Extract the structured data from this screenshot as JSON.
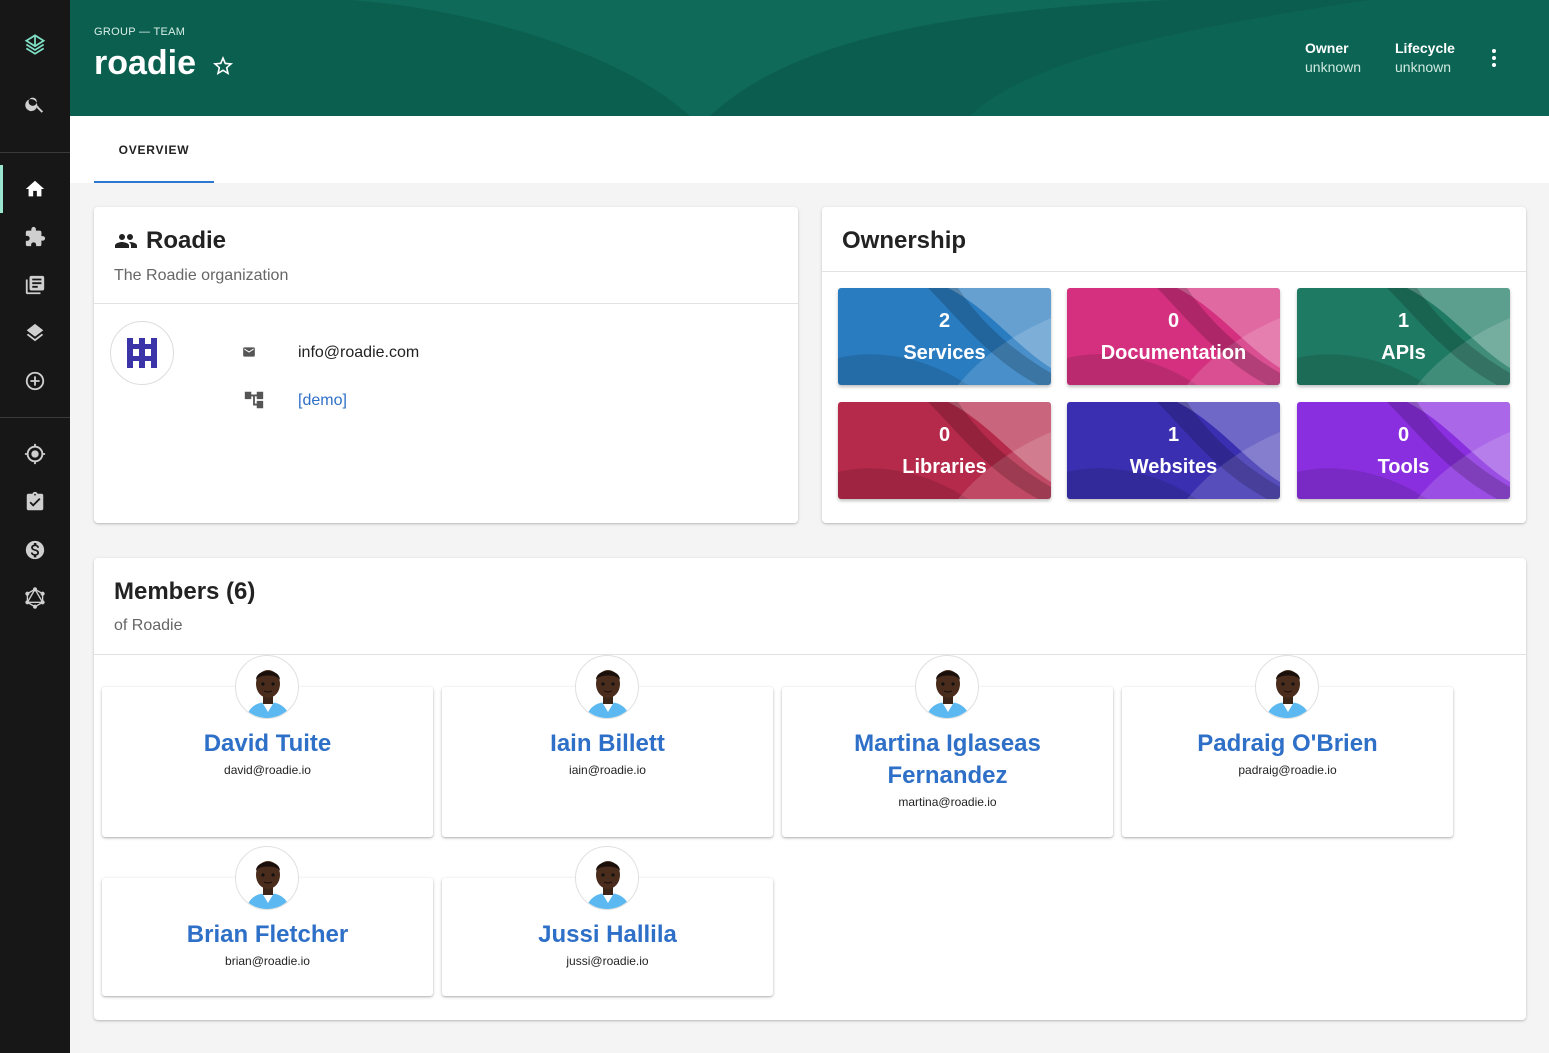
{
  "header": {
    "type_label": "GROUP — TEAM",
    "title": "roadie",
    "owner_label": "Owner",
    "owner_value": "unknown",
    "lifecycle_label": "Lifecycle",
    "lifecycle_value": "unknown",
    "background_color": "#0b5f4f"
  },
  "tabs": [
    {
      "label": "OVERVIEW",
      "active": true
    }
  ],
  "sidebar": {
    "items": [
      "logo-icon",
      "search-icon",
      "home-icon",
      "puzzle-icon",
      "library-icon",
      "layers-icon",
      "add-circle-icon",
      "target-icon",
      "assignment-icon",
      "dollar-icon",
      "graphql-icon"
    ],
    "active": "home-icon"
  },
  "group_card": {
    "title": "Roadie",
    "description": "The Roadie organization",
    "email": "info@roadie.com",
    "parent": "[demo]"
  },
  "ownership": {
    "title": "Ownership",
    "tiles": [
      {
        "count": "2",
        "label": "Services",
        "color": "#2a7cc0"
      },
      {
        "count": "0",
        "label": "Documentation",
        "color": "#d4307f"
      },
      {
        "count": "1",
        "label": "APIs",
        "color": "#1f7a63"
      },
      {
        "count": "0",
        "label": "Libraries",
        "color": "#b52a4a"
      },
      {
        "count": "1",
        "label": "Websites",
        "color": "#3a2fb0"
      },
      {
        "count": "0",
        "label": "Tools",
        "color": "#8a2fe0"
      }
    ]
  },
  "members": {
    "title": "Members (6)",
    "subtitle": "of Roadie",
    "list": [
      {
        "name": "David Tuite",
        "email": "david@roadie.io"
      },
      {
        "name": "Iain Billett",
        "email": "iain@roadie.io"
      },
      {
        "name": "Martina Iglaseas Fernandez",
        "email": "martina@roadie.io"
      },
      {
        "name": "Padraig O'Brien",
        "email": "padraig@roadie.io"
      },
      {
        "name": "Brian Fletcher",
        "email": "brian@roadie.io"
      },
      {
        "name": "Jussi Hallila",
        "email": "jussi@roadie.io"
      }
    ]
  }
}
